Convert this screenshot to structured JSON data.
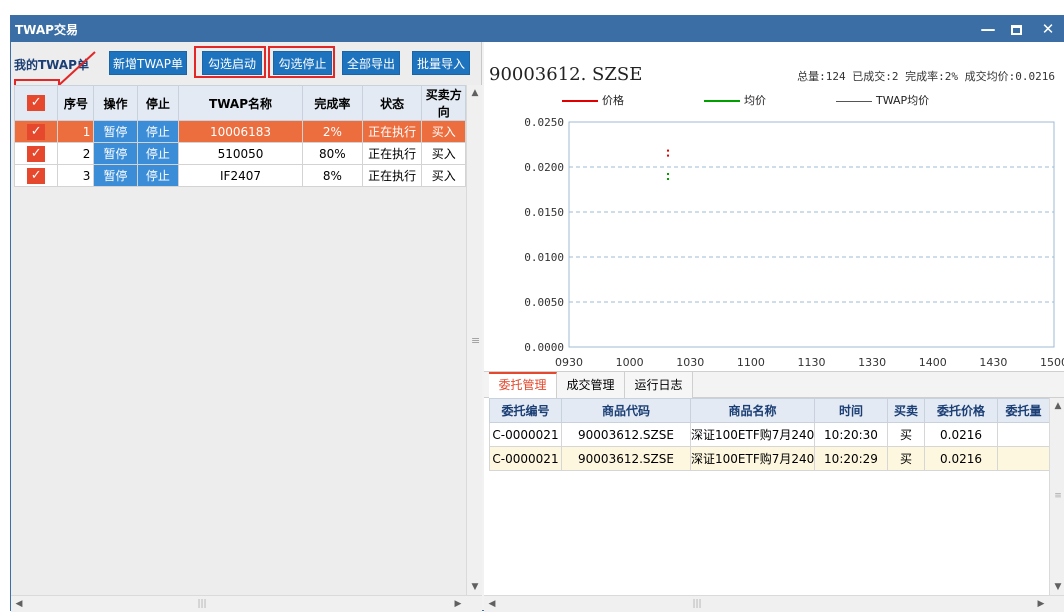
{
  "window": {
    "title": "TWAP交易",
    "minimize_glyph": "—",
    "close_glyph": "✕"
  },
  "left": {
    "section_title": "我的TWAP单",
    "buttons": {
      "new_twap": "新增TWAP单",
      "check_start": "勾选启动",
      "check_stop": "勾选停止",
      "export_all": "全部导出",
      "batch_import": "批量导入"
    },
    "columns": [
      "",
      "序号",
      "操作",
      "停止",
      "TWAP名称",
      "完成率",
      "状态",
      "买卖方向"
    ],
    "rows": [
      {
        "index": "1",
        "action": "暂停",
        "stop": "停止",
        "name": "10006183",
        "rate": "2%",
        "status": "正在执行",
        "side": "买入"
      },
      {
        "index": "2",
        "action": "暂停",
        "stop": "停止",
        "name": "510050",
        "rate": "80%",
        "status": "正在执行",
        "side": "买入"
      },
      {
        "index": "3",
        "action": "暂停",
        "stop": "停止",
        "name": "IF2407",
        "rate": "8%",
        "status": "正在执行",
        "side": "买入"
      }
    ],
    "check_glyph": "✓",
    "selected_row": 1
  },
  "chart_header": {
    "symbol": "90003612. SZSE",
    "summary": "总量:124 已成交:2 完成率:2% 成交均价:0.0216"
  },
  "chart_data": {
    "type": "line",
    "series": [
      {
        "name": "价格",
        "color": "#e00000",
        "x": [
          "1019"
        ],
        "y": [
          0.0216
        ]
      },
      {
        "name": "均价",
        "color": "#00a000",
        "x": [
          "1019"
        ],
        "y": [
          0.019
        ]
      },
      {
        "name": "TWAP均价",
        "color": "#555555",
        "x": [],
        "y": []
      }
    ],
    "x_ticks": [
      "0930",
      "1000",
      "1030",
      "1100",
      "1130",
      "1330",
      "1400",
      "1430",
      "1500"
    ],
    "y_ticks": [
      "0.0250",
      "0.0200",
      "0.0150",
      "0.0100",
      "0.0050",
      "0.0000"
    ],
    "ylim": [
      0,
      0.025
    ],
    "grid": true,
    "legend_position": "top"
  },
  "tabs": [
    "委托管理",
    "成交管理",
    "运行日志"
  ],
  "orders": {
    "columns": [
      "委托编号",
      "商品代码",
      "商品名称",
      "时间",
      "买卖",
      "委托价格",
      "委托量"
    ],
    "rows": [
      {
        "id": "C-0000021",
        "code": "90003612.SZSE",
        "name": "深证100ETF购7月240C",
        "time": "10:20:30",
        "side": "买",
        "price": "0.0216",
        "qty": ""
      },
      {
        "id": "C-0000021",
        "code": "90003612.SZSE",
        "name": "深证100ETF购7月240C",
        "time": "10:20:29",
        "side": "买",
        "price": "0.0216",
        "qty": ""
      }
    ]
  },
  "colors": {
    "title_bar": "#3a6ea5",
    "button_blue": "#1e73be",
    "selected_row": "#ec6d3e",
    "highlight_box": "#e32626"
  }
}
